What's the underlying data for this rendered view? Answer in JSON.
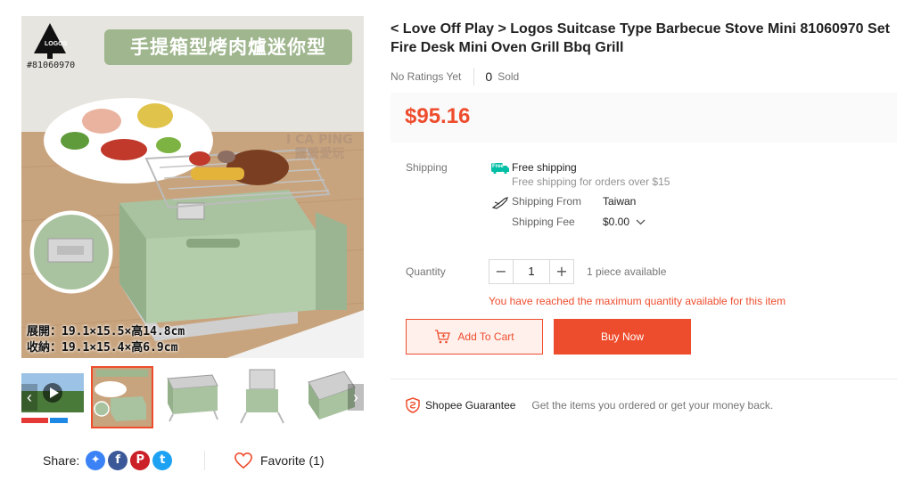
{
  "product": {
    "title": "< Love Off Play > Logos Suitcase Type Barbecue Stove Mini 81060970 Set Fire Desk Mini Oven Grill Bbq Grill",
    "rating_text": "No Ratings Yet",
    "sold_count": "0",
    "sold_label": "Sold",
    "price": "$95.16"
  },
  "image": {
    "banner_text": "手提箱型烤肉爐迷你型",
    "model_number": "#81060970",
    "logo_text": "LOGOS",
    "watermark_line1": "I CA PING",
    "watermark_line2": "露營愛玩",
    "dims_line1": "展開：19.1×15.5×高14.8cm",
    "dims_line2": "收納：19.1×15.4×高6.9cm"
  },
  "shipping": {
    "label": "Shipping",
    "free_badge_text": "Free",
    "free_title": "Free shipping",
    "free_subtitle": "Free shipping for orders over $15",
    "from_label": "Shipping From",
    "from_value": "Taiwan",
    "fee_label": "Shipping Fee",
    "fee_value": "$0.00"
  },
  "quantity": {
    "label": "Quantity",
    "minus": "−",
    "value": "1",
    "plus": "+",
    "available": "1 piece available",
    "max_warning": "You have reached the maximum quantity available for this item"
  },
  "actions": {
    "add_to_cart": "Add To Cart",
    "buy_now": "Buy Now"
  },
  "guarantee": {
    "title": "Shopee Guarantee",
    "text": "Get the items you ordered or get your money back."
  },
  "share": {
    "label": "Share:",
    "messenger_glyph": "✦",
    "facebook_glyph": "f",
    "pinterest_glyph": "P",
    "twitter_glyph": "t"
  },
  "favorite": {
    "label": "Favorite (1)"
  },
  "thumbnails": {
    "prev_glyph": "‹",
    "next_glyph": "›"
  },
  "colors": {
    "accent": "#ee4d2d",
    "price_bg": "#fafafa",
    "stove_green": "#a9c3a0"
  }
}
